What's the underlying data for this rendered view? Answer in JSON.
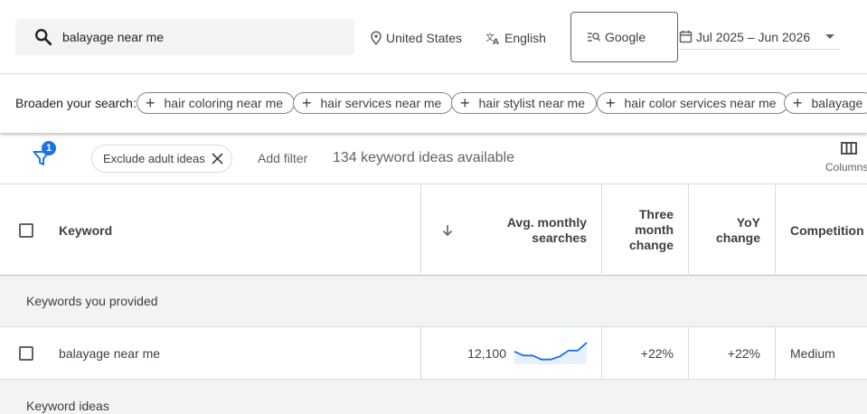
{
  "search": {
    "query": "balayage near me"
  },
  "location": {
    "label": "United States",
    "icon": "location-pin-icon"
  },
  "language": {
    "label": "English",
    "icon": "translate-icon"
  },
  "network": {
    "label": "Google",
    "icon": "search-network-icon"
  },
  "date_range": {
    "label": "Jul 2025 – Jun 2026",
    "icon": "calendar-icon"
  },
  "broaden": {
    "label": "Broaden your search:",
    "chips": [
      "hair coloring near me",
      "hair services near me",
      "hair stylist near me",
      "hair color services near me",
      "balayage"
    ]
  },
  "filters": {
    "badge_count": "1",
    "exclude_chip": "Exclude adult ideas",
    "add_filter": "Add filter",
    "ideas_count": "134 keyword ideas available",
    "columns_label": "Columns"
  },
  "table": {
    "headers": {
      "keyword": "Keyword",
      "avg_monthly_line1": "Avg. monthly",
      "avg_monthly_line2": "searches",
      "three_month_line1": "Three",
      "three_month_line2": "month",
      "three_month_line3": "change",
      "yoy_line1": "YoY",
      "yoy_line2": "change",
      "competition": "Competition"
    },
    "groups": {
      "provided": "Keywords you provided",
      "ideas": "Keyword ideas"
    },
    "rows": [
      {
        "keyword": "balayage near me",
        "avg_monthly": "12,100",
        "trend": [
          0.55,
          0.35,
          0.35,
          0.15,
          0.15,
          0.3,
          0.6,
          0.6,
          1.0
        ],
        "three_month": "+22%",
        "yoy": "+22%",
        "competition": "Medium"
      }
    ]
  },
  "colors": {
    "accent": "#1a73e8",
    "trend_fill": "#e8f0fe"
  }
}
